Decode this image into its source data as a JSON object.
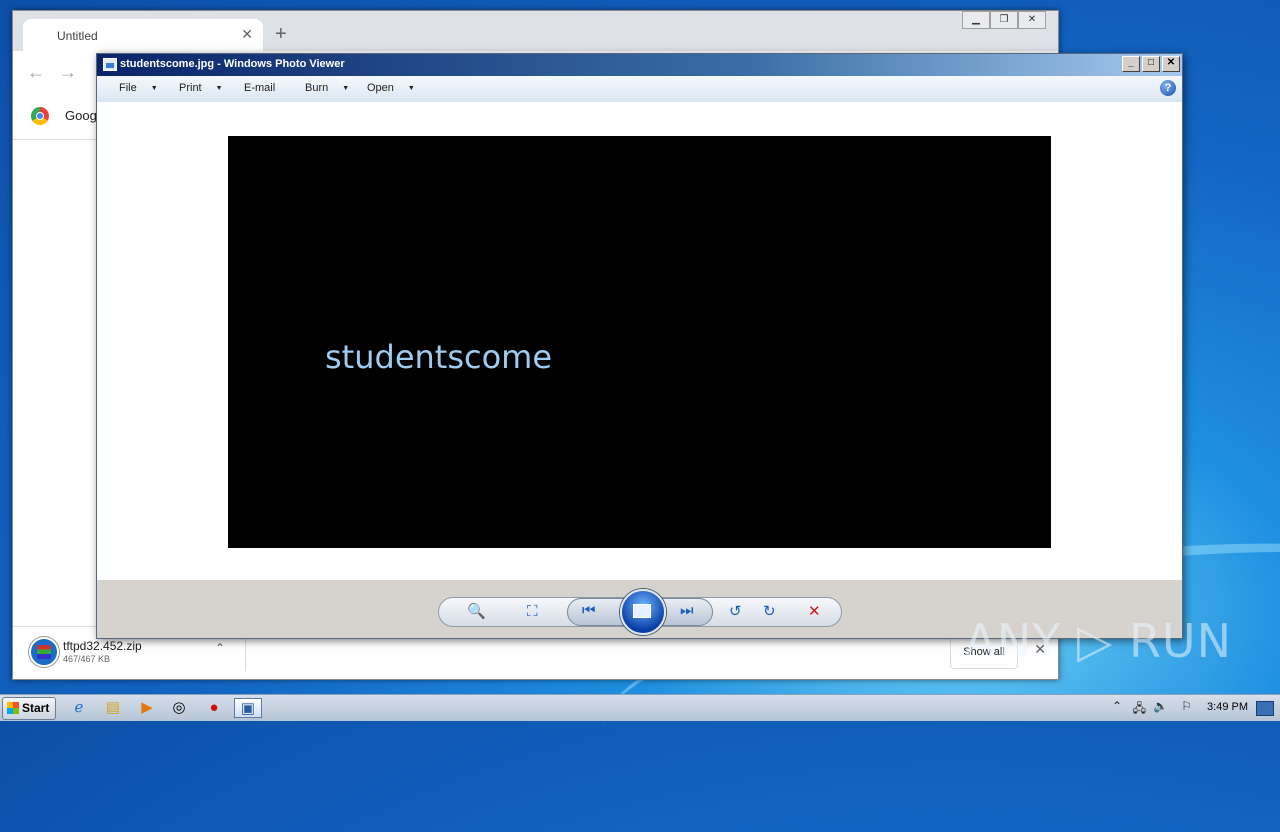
{
  "chrome": {
    "tab_title": "Untitled",
    "tab_close": "✕",
    "new_tab": "+",
    "win_buttons": [
      "▁",
      "❐",
      "✕"
    ],
    "back": "←",
    "forward": "→",
    "bookmark_label": "Googl",
    "download": {
      "file_name": "tftpd32.452.zip",
      "file_size": "467/467 KB",
      "show_all": "Show all",
      "close": "✕",
      "caret": "⌃"
    }
  },
  "photo_viewer": {
    "title": "studentscome.jpg - Windows Photo Viewer",
    "win_buttons": [
      "_",
      "□",
      "✕"
    ],
    "menu": {
      "file": "File",
      "print": "Print",
      "email": "E-mail",
      "burn": "Burn",
      "open": "Open"
    },
    "help": "?",
    "photo_text": "studentscome",
    "controls": {
      "zoom": "🔍",
      "fit": "⛶",
      "previous": "⏮",
      "next": "⏭",
      "rotate_left": "↺",
      "rotate_right": "↻",
      "delete": "✕"
    }
  },
  "taskbar": {
    "start_label": "Start",
    "clock": "3:49 PM",
    "tray_arrow": "⌃"
  },
  "watermark": "ANY ▷ RUN"
}
